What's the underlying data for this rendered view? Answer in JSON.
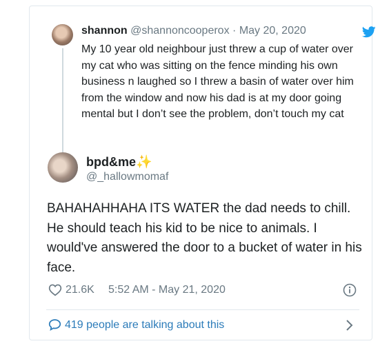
{
  "quoted_tweet": {
    "name": "shannon",
    "handle": "@shannoncooperox",
    "separator": "·",
    "date": "May 20, 2020",
    "text": "My 10 year old neighbour just threw a cup of water over my cat who was sitting on the fence minding his own business n laughed so I threw a basin of water over him from the window and now his dad is at my door going mental but I don’t see the problem, don’t touch my cat"
  },
  "tweet": {
    "name": "bpd&me",
    "name_emoji": "✨",
    "handle": "@_hallowmomaf",
    "text": "BAHAHAHHAHA ITS WATER the dad needs to chill. He should teach his kid to be nice to animals. I would've answered the door to a bucket of water in his face.",
    "likes": "21.6K",
    "timestamp": "5:52 AM - May 21, 2020"
  },
  "footer": {
    "talking_text": "419 people are talking about this"
  },
  "icons": {
    "twitter": "twitter-bird-icon",
    "like": "heart-icon",
    "info": "info-icon",
    "reply": "speech-bubble-icon",
    "chevron": "chevron-right-icon"
  },
  "colors": {
    "twitter_blue": "#1da1f2",
    "link_blue": "#2b7bb9",
    "muted": "#697882",
    "text": "#1c2022",
    "border": "#e1e8ed"
  }
}
